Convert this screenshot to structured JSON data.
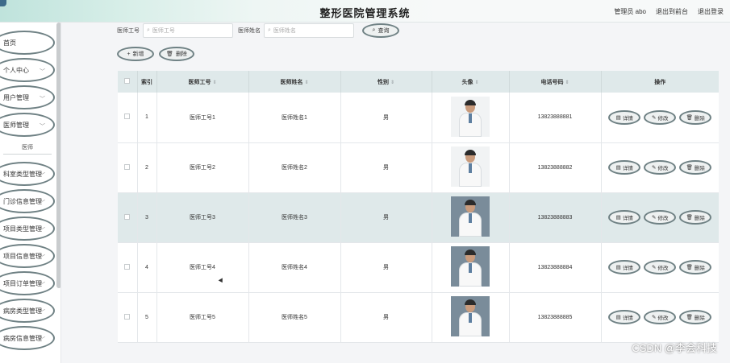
{
  "header": {
    "title": "整形医院管理系统",
    "links": [
      "管理员 abo",
      "退出到前台",
      "退出登录"
    ]
  },
  "sidebar": {
    "items": [
      {
        "label": "首页"
      },
      {
        "label": "个人中心"
      },
      {
        "label": "用户管理"
      },
      {
        "label": "医师管理"
      },
      {
        "label": "科室类型管理"
      },
      {
        "label": "门诊信息管理"
      },
      {
        "label": "项目类型管理"
      },
      {
        "label": "项目信息管理"
      },
      {
        "label": "项目订单管理"
      },
      {
        "label": "病房类型管理"
      },
      {
        "label": "病房信息管理"
      }
    ],
    "sub_item": "医师"
  },
  "search": {
    "field1_label": "医师工号",
    "field1_placeholder": "医师工号",
    "field2_label": "医师姓名",
    "field2_placeholder": "医师姓名",
    "search_button": "查询"
  },
  "actions": {
    "add": "新增",
    "delete": "删除"
  },
  "table": {
    "headers": [
      "索引",
      "医师工号",
      "医师姓名",
      "性别",
      "头像",
      "电话号码",
      "操作"
    ],
    "rows": [
      {
        "index": "1",
        "id": "医师工号1",
        "name": "医师姓名1",
        "gender": "男",
        "phone": "13823888881"
      },
      {
        "index": "2",
        "id": "医师工号2",
        "name": "医师姓名2",
        "gender": "男",
        "phone": "13823888882"
      },
      {
        "index": "3",
        "id": "医师工号3",
        "name": "医师姓名3",
        "gender": "男",
        "phone": "13823888883"
      },
      {
        "index": "4",
        "id": "医师工号4",
        "name": "医师姓名4",
        "gender": "男",
        "phone": "13823888884"
      },
      {
        "index": "5",
        "id": "医师工号5",
        "name": "医师姓名5",
        "gender": "男",
        "phone": "13823888885"
      }
    ],
    "row_buttons": {
      "detail": "详情",
      "edit": "修改",
      "delete": "删除"
    }
  },
  "watermark": "CSDN @李会科技",
  "colors": {
    "accent": "#dfe9ea",
    "border": "#6f8184"
  }
}
